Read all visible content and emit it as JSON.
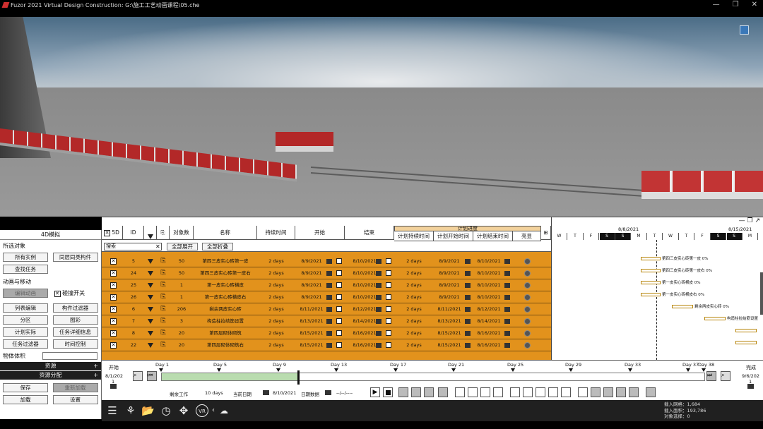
{
  "window": {
    "title": "Fuzor 2021 Virtual Design Construction: G:\\施工工艺动画课程\\05.che",
    "min": "—",
    "max": "❐",
    "close": "✕"
  },
  "left_panel": {
    "title": "4D模拟",
    "selection_label": "所选对象",
    "btn_all_instances": "所有实例",
    "btn_same_type": "同层同类构件",
    "btn_find_task": "查找任务",
    "anim_label": "动画与移动",
    "btn_edit_anim": "编辑动画",
    "collision_label": "碰撞开关",
    "btn_list_edit": "列表编辑",
    "btn_component_filter": "构件过滤器",
    "btn_partition": "分区",
    "btn_color": "图彩",
    "btn_plan_actual": "计划实际",
    "btn_task_detail": "任务详细信息",
    "btn_task_filter": "任务过滤器",
    "btn_time_control": "时间控制",
    "volume_label": "物体体积",
    "resources": "资源",
    "resource_alloc": "资源分配",
    "btn_save": "保存",
    "btn_reset": "重新加载",
    "btn_load": "加载",
    "btn_settings": "设置"
  },
  "grid": {
    "headers": {
      "x": "5D",
      "id": "ID",
      "count": "对象数",
      "name": "名称",
      "duration": "持续时间",
      "start": "开始",
      "end": "结束",
      "plan_group": "计划进度",
      "plan_duration": "计划持续时间",
      "plan_start": "计划开始时间",
      "plan_end": "计划结束时间",
      "highlight": "亮显"
    },
    "search_placeholder": "搜索",
    "btn_expand": "全部展开",
    "btn_collapse": "全部折叠",
    "rows": [
      {
        "id": "5",
        "count": "50",
        "name": "第四三皮实心砖第一皮",
        "dur": "2 days",
        "start": "8/9/2021",
        "end": "8/10/2021",
        "pdur": "2 days",
        "pstart": "8/9/2021",
        "pend": "8/10/2021"
      },
      {
        "id": "24",
        "count": "50",
        "name": "第四三皮实心砖第一皮右",
        "dur": "2 days",
        "start": "8/9/2021",
        "end": "8/10/2021",
        "pdur": "2 days",
        "pstart": "8/9/2021",
        "pend": "8/10/2021"
      },
      {
        "id": "25",
        "count": "1",
        "name": "第一皮实心砖横皮",
        "dur": "2 days",
        "start": "8/9/2021",
        "end": "8/10/2021",
        "pdur": "2 days",
        "pstart": "8/9/2021",
        "pend": "8/10/2021"
      },
      {
        "id": "26",
        "count": "1",
        "name": "第一皮实心砖横皮右",
        "dur": "2 days",
        "start": "8/9/2021",
        "end": "8/10/2021",
        "pdur": "2 days",
        "pstart": "8/9/2021",
        "pend": "8/10/2021"
      },
      {
        "id": "6",
        "count": "206",
        "name": "剩余两皮实心砖",
        "dur": "2 days",
        "start": "8/11/2021",
        "end": "8/12/2021",
        "pdur": "2 days",
        "pstart": "8/11/2021",
        "pend": "8/12/2021"
      },
      {
        "id": "7",
        "count": "3",
        "name": "构造柱拉结筋设置",
        "dur": "2 days",
        "start": "8/13/2021",
        "end": "8/14/2021",
        "pdur": "2 days",
        "pstart": "8/13/2021",
        "pend": "8/14/2021"
      },
      {
        "id": "8",
        "count": "20",
        "name": "第四层砌体砌筑",
        "dur": "2 days",
        "start": "8/15/2021",
        "end": "8/16/2021",
        "pdur": "2 days",
        "pstart": "8/15/2021",
        "pend": "8/16/2021"
      },
      {
        "id": "22",
        "count": "20",
        "name": "第四层砌体砌筑右",
        "dur": "2 days",
        "start": "8/15/2021",
        "end": "8/16/2021",
        "pdur": "2 days",
        "pstart": "8/15/2021",
        "pend": "8/16/2021"
      }
    ]
  },
  "gantt": {
    "date1": "8/8/2021",
    "date2": "8/15/2021",
    "days": [
      "W",
      "T",
      "F",
      "S",
      "S",
      "M",
      "T",
      "W",
      "T",
      "F",
      "S",
      "S",
      "M"
    ],
    "labels": [
      "第四三皮实心砖第一皮  0%",
      "第四三皮实心砖第一皮右  0%",
      "第一皮实心砖横皮  0%",
      "第一皮实心砖横皮右  0%",
      "剩余两皮实心砖  0%",
      "构造柱拉结筋设置"
    ]
  },
  "timeline": {
    "start_label": "开始",
    "start_date": "8/1/202",
    "start_num": "1",
    "end_label": "完成",
    "end_date": "9/6/202",
    "end_num": "1",
    "ticks": [
      "Day 1",
      "Day 5",
      "Day 9",
      "Day 13",
      "Day 17",
      "Day 21",
      "Day 25",
      "Day 29",
      "Day 33",
      "Day 37",
      "Day 38"
    ],
    "remaining_label": "剩余工作",
    "remaining_val": "10 days",
    "current_label": "当前日期",
    "current_val": "8/10/2021",
    "date_data_label": "日期数据",
    "date_data_val": "--/--/----"
  },
  "stats": {
    "line1": "载入网格：1,684",
    "line2": "载入面积：193,786",
    "line3": "对象选择：0"
  }
}
